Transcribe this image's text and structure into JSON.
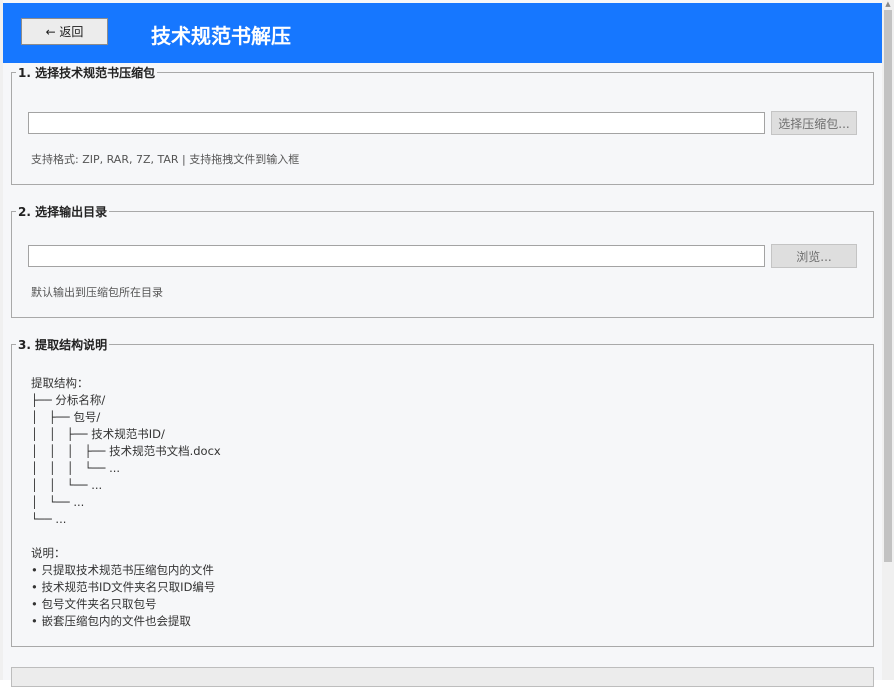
{
  "header": {
    "back_label": "← 返回",
    "title": "技术规范书解压"
  },
  "section1": {
    "legend": "1. 选择技术规范书压缩包",
    "input_value": "",
    "button_label": "选择压缩包...",
    "hint": "支持格式: ZIP, RAR, 7Z, TAR  |  支持拖拽文件到输入框"
  },
  "section2": {
    "legend": "2. 选择输出目录",
    "input_value": "",
    "button_label": "浏览...",
    "hint": "默认输出到压缩包所在目录"
  },
  "section3": {
    "legend": "3. 提取结构说明",
    "structure_heading": "提取结构：",
    "tree": [
      "├── 分标名称/",
      "│   ├── 包号/",
      "│   │   ├── 技术规范书ID/",
      "│   │   │   ├── 技术规范书文档.docx",
      "│   │   │   └── ...",
      "│   │   └── ...",
      "│   └── ...",
      "└── ..."
    ],
    "notes_heading": "说明：",
    "notes": [
      "• 只提取技术规范书压缩包内的文件",
      "• 技术规范书ID文件夹名只取ID编号",
      "• 包号文件夹名只取包号",
      "• 嵌套压缩包内的文件也会提取"
    ]
  },
  "colors": {
    "header_bg": "#1677ff",
    "header_text": "#ffffff",
    "window_bg": "#f6f7f9",
    "disabled_button_bg": "#dedede"
  }
}
